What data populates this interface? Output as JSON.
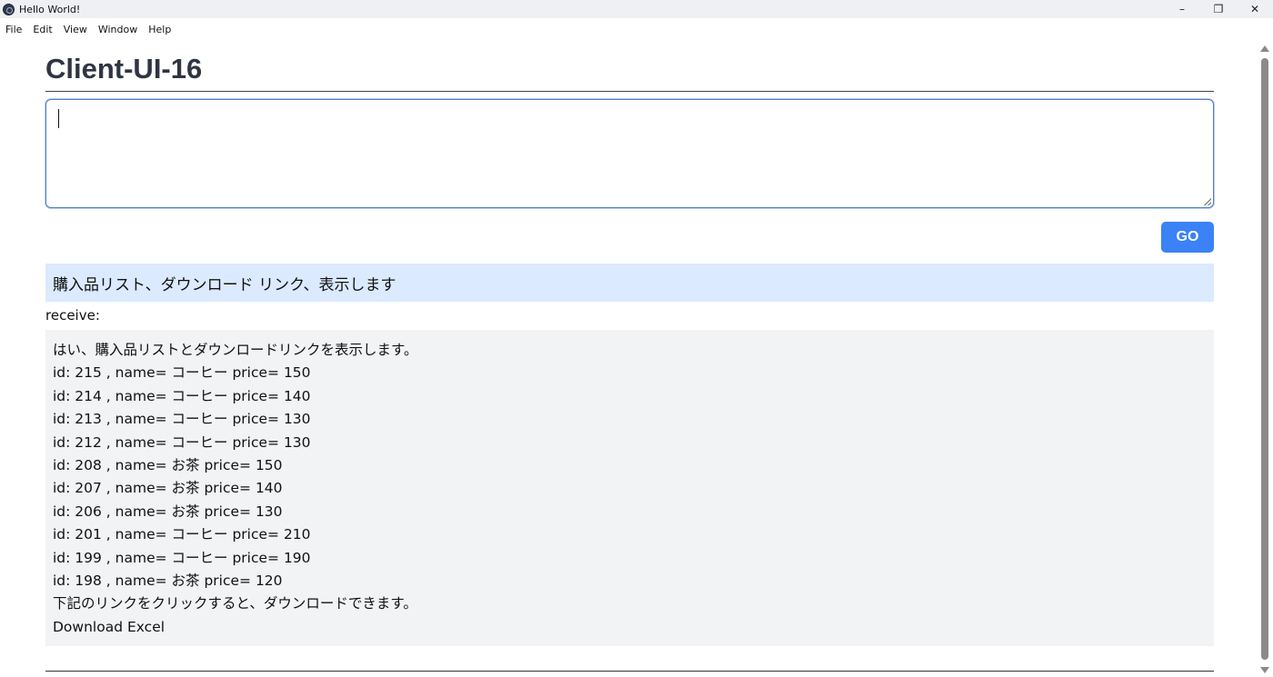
{
  "window": {
    "title": "Hello World!",
    "minimize_glyph": "–",
    "maximize_glyph": "❐",
    "close_glyph": "✕"
  },
  "menu": {
    "items": [
      "File",
      "Edit",
      "View",
      "Window",
      "Help"
    ]
  },
  "page": {
    "title": "Client-UI-16"
  },
  "prompt": {
    "value": "",
    "placeholder": ""
  },
  "go_button": {
    "label": "GO"
  },
  "query_banner": {
    "text": "購入品リスト、ダウンロード リンク、表示します"
  },
  "receive": {
    "label": "receive:",
    "lines": [
      "はい、購入品リストとダウンロードリンクを表示します。",
      "id: 215 , name= コーヒー price= 150",
      "id: 214 , name= コーヒー price= 140",
      "id: 213 , name= コーヒー price= 130",
      "id: 212 , name= コーヒー price= 130",
      "id: 208 , name= お茶 price= 150",
      "id: 207 , name= お茶 price= 140",
      "id: 206 , name= お茶 price= 130",
      "id: 201 , name= コーヒー price= 210",
      "id: 199 , name= コーヒー price= 190",
      "id: 198 , name= お茶 price= 120",
      "下記のリンクをクリックすると、ダウンロードできます。"
    ],
    "download_link": "Download Excel"
  },
  "colors": {
    "go_button": "#3b82f6",
    "banner_bg": "#dbeafe",
    "response_bg": "#f2f3f5",
    "title_text": "#2f3542"
  }
}
